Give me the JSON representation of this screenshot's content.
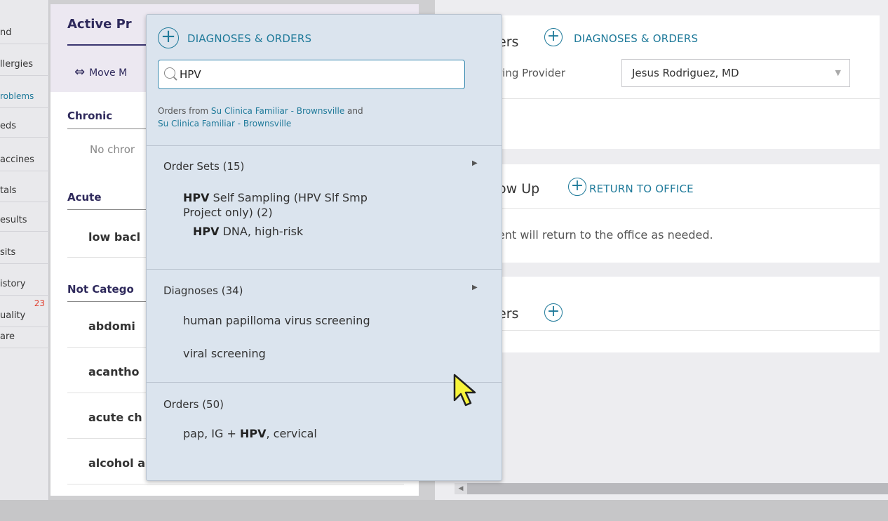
{
  "left_nav": {
    "items": [
      {
        "label": "nd"
      },
      {
        "label": "llergies"
      },
      {
        "label": "roblems"
      },
      {
        "label": "eds"
      },
      {
        "label": "accines"
      },
      {
        "label": "tals"
      },
      {
        "label": "esults"
      },
      {
        "label": "sits"
      },
      {
        "label": "istory"
      },
      {
        "label": "uality",
        "badge": "23"
      },
      {
        "label": "are"
      }
    ]
  },
  "left_panel": {
    "title": "Active Pr",
    "move_label": "Move M",
    "move_arrow": "⇔",
    "chronic_heading": "Chronic",
    "chronic_empty": "No chror",
    "acute_heading": "Acute",
    "acute_item": "low bacl",
    "uncat_heading": "Not Catego",
    "uncat_items": [
      "abdomi",
      "acantho",
      "acute ch",
      "alcohol a"
    ]
  },
  "right": {
    "orders_title": "ers",
    "orders_link": "DIAGNOSES & ORDERS",
    "ordering_provider_label": "ring Provider",
    "ordering_provider_value": "Jesus Rodriguez, MD",
    "followup_title": "ow Up",
    "followup_link": "RETURN TO OFFICE",
    "followup_text": "ent will return to the office as needed.",
    "others_title": "ers"
  },
  "dropdown": {
    "title": "DIAGNOSES & ORDERS",
    "search_value": "HPV",
    "note_prefix": "Orders from ",
    "note_link1": "Su Clinica Familiar - Brownsville",
    "note_and": " and",
    "note_link2": "Su Clinica Familiar - Brownsville",
    "order_sets_label": "Order Sets (15)",
    "order_sets": [
      {
        "bold": "HPV",
        "rest": " Self Sampling (HPV Slf Smp"
      },
      {
        "bold": "",
        "rest": "Project only) (2)"
      },
      {
        "bold": "HPV",
        "rest": " DNA, high-risk"
      }
    ],
    "diagnoses_label": "Diagnoses (34)",
    "diagnoses": [
      "human papilloma virus screening",
      "viral screening"
    ],
    "orders_label": "Orders (50)",
    "orders": [
      {
        "prefix": "pap, IG + ",
        "bold": "HPV",
        "suffix": ", cervical"
      }
    ]
  },
  "colors": {
    "accent": "#1f7a9a",
    "heading": "#2f2a5c",
    "dropdown_bg": "#dbe4ee"
  }
}
